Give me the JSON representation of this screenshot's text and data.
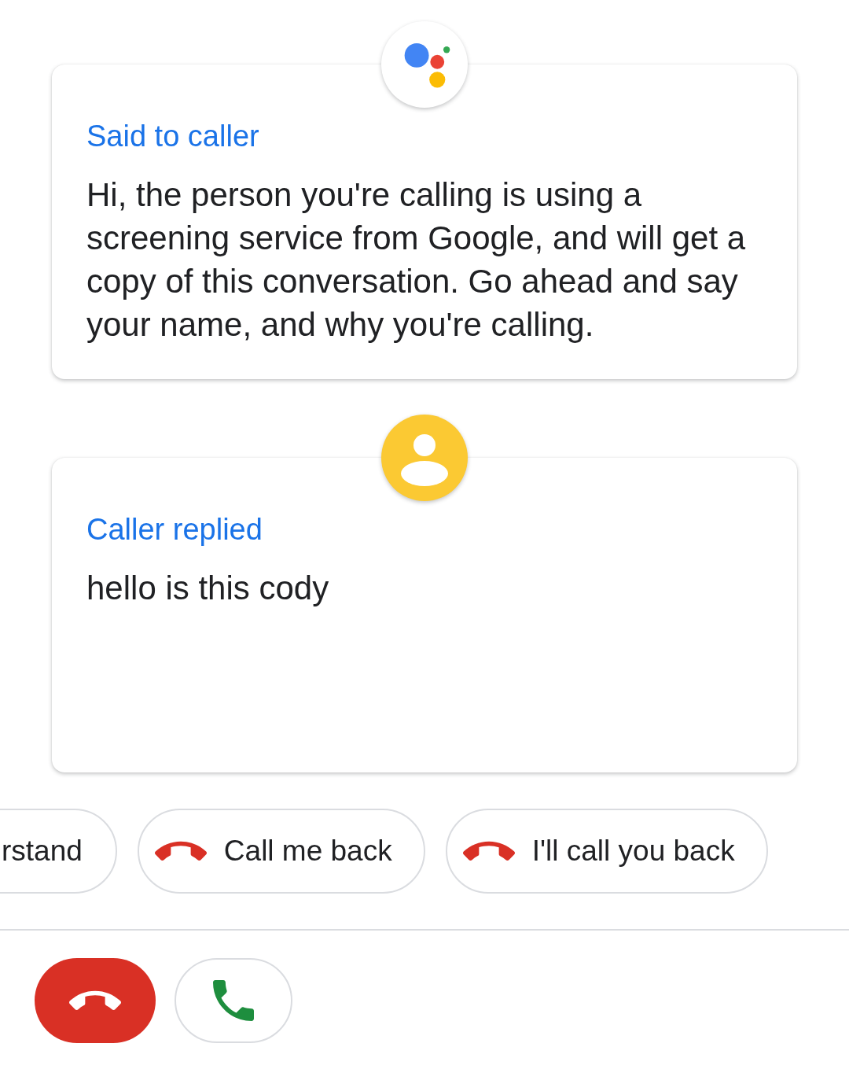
{
  "cards": [
    {
      "kind": "assistant",
      "title": "Said to caller",
      "text": "Hi, the person you're calling is using a screening service from Google, and will get a copy of this conversation. Go ahead and say your name, and why you're calling."
    },
    {
      "kind": "caller",
      "title": "Caller replied",
      "text": "hello is this cody"
    }
  ],
  "replies": [
    {
      "label": "rstand"
    },
    {
      "label": "Call me back",
      "kind": "hangup"
    },
    {
      "label": "I'll call you back",
      "kind": "hangup"
    }
  ],
  "actions": [
    {
      "kind": "decline"
    },
    {
      "kind": "answer"
    }
  ]
}
